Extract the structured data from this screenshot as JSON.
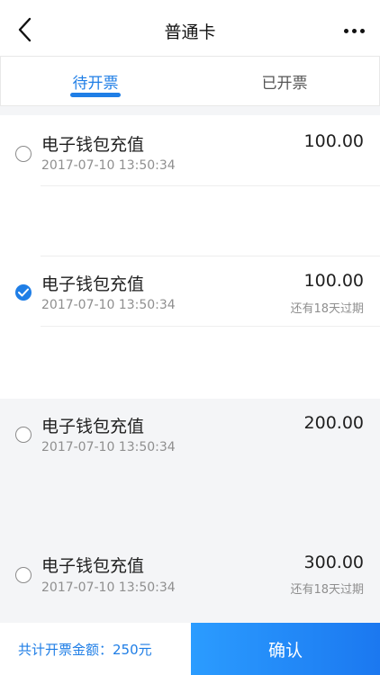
{
  "header": {
    "title": "普通卡"
  },
  "tabs": [
    {
      "label": "待开票",
      "active": true
    },
    {
      "label": "已开票",
      "active": false
    }
  ],
  "items": [
    {
      "name": "电子钱包充值",
      "time": "2017-07-10 13:50:34",
      "amount": "100.00",
      "expire": "",
      "selected": false
    },
    {
      "name": "电子钱包充值",
      "time": "2017-07-10 13:50:34",
      "amount": "100.00",
      "expire": "还有18天过期",
      "selected": true
    },
    {
      "name": "电子钱包充值",
      "time": "2017-07-10 13:50:34",
      "amount": "200.00",
      "expire": "",
      "selected": false
    },
    {
      "name": "电子钱包充值",
      "time": "2017-07-10 13:50:34",
      "amount": "300.00",
      "expire": "还有18天过期",
      "selected": false
    }
  ],
  "bottom_bar": {
    "total_label": "共计开票金额：",
    "total_amount": "250元",
    "confirm_label": "确认"
  },
  "icons": {
    "back": "back-icon",
    "more": "more-icon",
    "radio_checked": "check-icon"
  },
  "colors": {
    "accent": "#1f7ee6",
    "background": "#f4f5f7"
  }
}
